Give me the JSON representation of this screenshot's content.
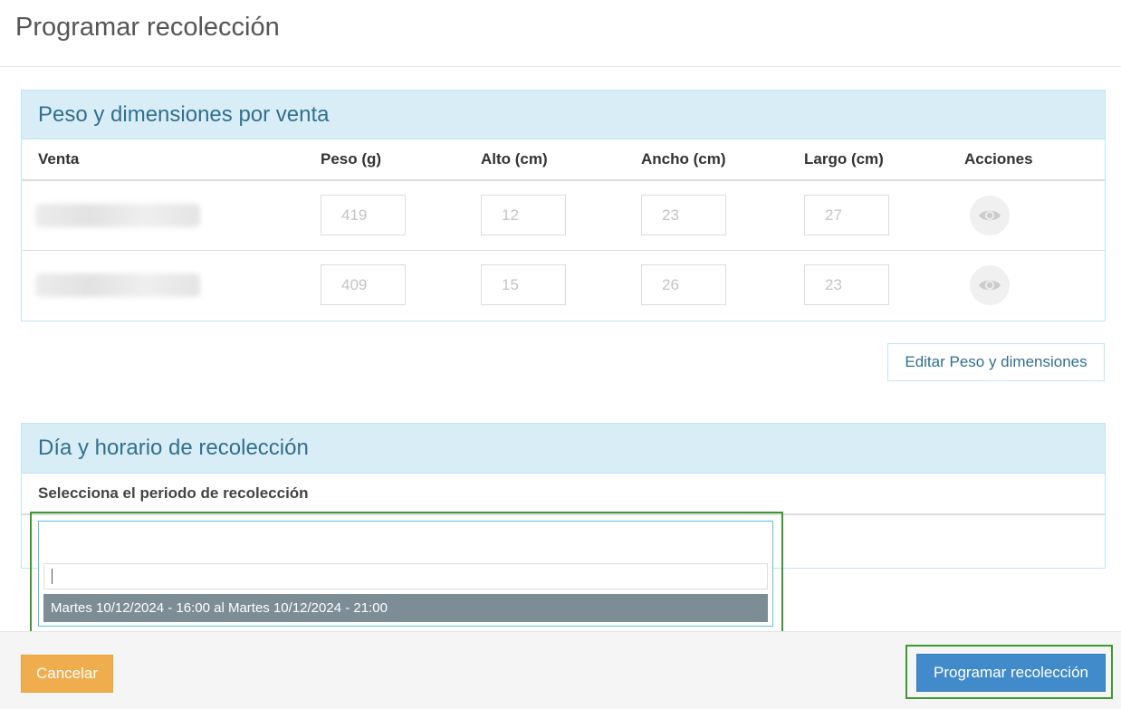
{
  "modal": {
    "title": "Programar recolección"
  },
  "weights_panel": {
    "title": "Peso y dimensiones por venta",
    "columns": [
      "Venta",
      "Peso (g)",
      "Alto (cm)",
      "Ancho (cm)",
      "Largo (cm)",
      "Acciones"
    ],
    "rows": [
      {
        "peso": "419",
        "alto": "12",
        "ancho": "23",
        "largo": "27"
      },
      {
        "peso": "409",
        "alto": "15",
        "ancho": "26",
        "largo": "23"
      }
    ],
    "action_icon": "eye-icon"
  },
  "edit_button_label": "Editar Peso y dimensiones",
  "schedule_panel": {
    "title": "Día y horario de recolección",
    "period_label": "Selecciona el periodo de recolección",
    "dropdown": {
      "search_value": "",
      "options": [
        "Martes 10/12/2024 - 16:00 al Martes 10/12/2024 - 21:00"
      ]
    }
  },
  "footer": {
    "cancel_label": "Cancelar",
    "submit_label": "Programar recolección"
  },
  "colors": {
    "panel_heading_bg": "#d9edf7",
    "panel_heading_text": "#31708f",
    "cancel": "#f0ad4e",
    "primary": "#428bca",
    "highlight": "#3c9b2d",
    "selected_option": "#7d8d95"
  }
}
